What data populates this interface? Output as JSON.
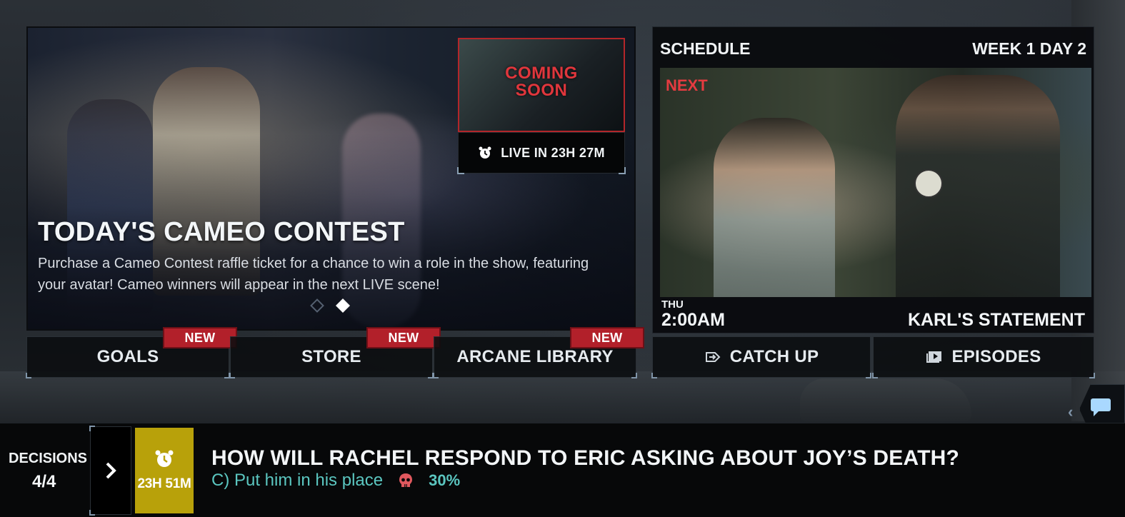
{
  "featured": {
    "coming_soon": "COMING\nSOON",
    "live_label": "LIVE IN 23H 27M",
    "title": "TODAY'S CAMEO CONTEST",
    "description": "Purchase a Cameo Contest raffle ticket for a chance to win a role in the show, featuring your avatar! Cameo winners will appear in the next LIVE scene!",
    "carousel": {
      "count": 2,
      "active_index": 1
    }
  },
  "nav": [
    {
      "label": "GOALS",
      "badge": "NEW"
    },
    {
      "label": "STORE",
      "badge": "NEW"
    },
    {
      "label": "ARCANE LIBRARY",
      "badge": "NEW"
    }
  ],
  "schedule": {
    "title": "SCHEDULE",
    "week_day": "WEEK 1 DAY 2",
    "next_label": "NEXT",
    "day": "THU",
    "time": "2:00AM",
    "episode": "KARL'S STATEMENT"
  },
  "actions": [
    {
      "label": "CATCH UP",
      "icon": "catch-up-icon"
    },
    {
      "label": "EPISODES",
      "icon": "episodes-icon"
    }
  ],
  "decisions": {
    "label": "DECISIONS",
    "count": "4/4",
    "timer": "23H 51M",
    "question": "HOW WILL RACHEL RESPOND TO ERIC ASKING ABOUT JOY’S DEATH?",
    "answer": "C) Put him in his place",
    "percent": "30%"
  },
  "colors": {
    "accent_red": "#b2202a",
    "next_red": "#e53b40",
    "teal": "#5bc6c0",
    "timer_yellow": "#b8a10a"
  }
}
